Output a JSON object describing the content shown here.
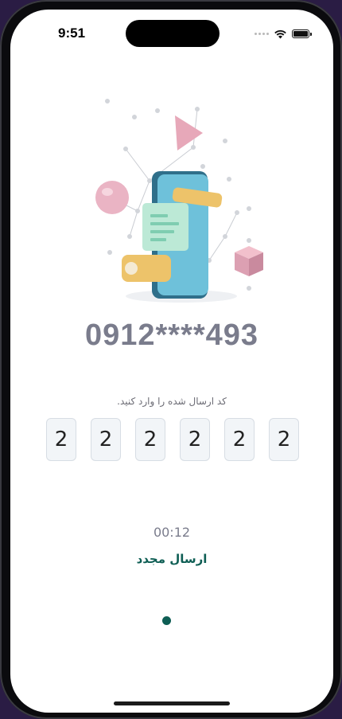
{
  "status_bar": {
    "time": "9:51"
  },
  "verification": {
    "phone_number": "0912****493",
    "instruction": "کد ارسال شده را وارد کنید.",
    "code_digits": [
      "2",
      "2",
      "2",
      "2",
      "2",
      "2"
    ],
    "timer": "00:12",
    "resend_label": "ارسال مجدد"
  },
  "colors": {
    "accent": "#0e5e54",
    "phone_number": "#7a7c8c",
    "code_box_bg": "#f2f5f8"
  },
  "icons": [
    "signal-icon",
    "wifi-icon",
    "battery-icon",
    "phone-verification-illustration"
  ]
}
